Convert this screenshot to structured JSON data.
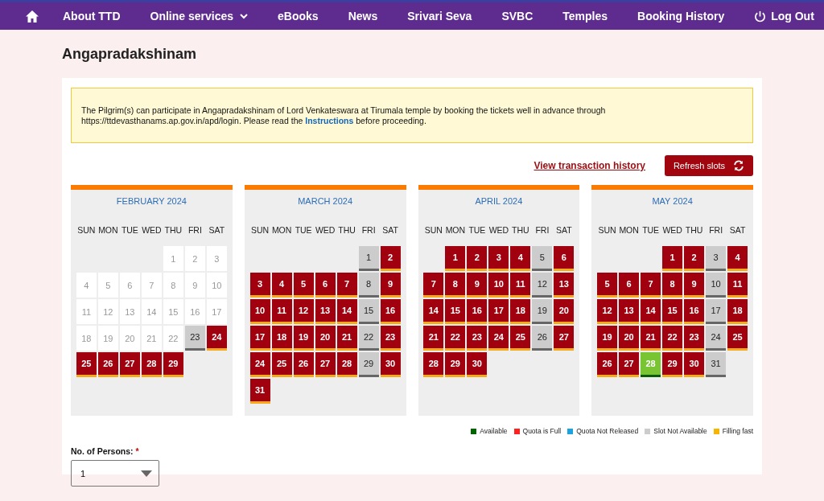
{
  "nav": {
    "items": [
      {
        "label": "About TTD",
        "dropdown": false
      },
      {
        "label": "Online services",
        "dropdown": true
      },
      {
        "label": "eBooks",
        "dropdown": false
      },
      {
        "label": "News",
        "dropdown": false
      },
      {
        "label": "Srivari Seva",
        "dropdown": false
      },
      {
        "label": "SVBC",
        "dropdown": false
      },
      {
        "label": "Temples",
        "dropdown": false
      },
      {
        "label": "Booking History",
        "dropdown": false
      }
    ],
    "logout": "Log Out"
  },
  "page_title": "Angapradakshinam",
  "notice": {
    "before": "The Pilgrim(s) can participate in Angapradakshinam of Lord Venkateswara at Tirumala temple by booking the tickets well in advance through https://ttdevasthanams.ap.gov.in/apd/login. Please read the",
    "link": "Instructions",
    "after": "before proceeding."
  },
  "history_link": "View transaction history",
  "refresh_button": "Refresh slots",
  "months": [
    {
      "title": "FEBRUARY 2024",
      "weekdays": [
        "SUN",
        "MON",
        "TUE",
        "WED",
        "THU",
        "FRI",
        "SAT"
      ],
      "weeks": [
        [
          {
            "kind": "empty"
          },
          {
            "kind": "empty"
          },
          {
            "kind": "empty"
          },
          {
            "kind": "empty"
          },
          {
            "day": "1",
            "kind": "past"
          },
          {
            "day": "2",
            "kind": "past"
          },
          {
            "day": "3",
            "kind": "past"
          }
        ],
        [
          {
            "day": "4",
            "kind": "past"
          },
          {
            "day": "5",
            "kind": "past"
          },
          {
            "day": "6",
            "kind": "past"
          },
          {
            "day": "7",
            "kind": "past"
          },
          {
            "day": "8",
            "kind": "past"
          },
          {
            "day": "9",
            "kind": "past"
          },
          {
            "day": "10",
            "kind": "past"
          }
        ],
        [
          {
            "day": "11",
            "kind": "past"
          },
          {
            "day": "12",
            "kind": "past"
          },
          {
            "day": "13",
            "kind": "past"
          },
          {
            "day": "14",
            "kind": "past"
          },
          {
            "day": "15",
            "kind": "past"
          },
          {
            "day": "16",
            "kind": "past"
          },
          {
            "day": "17",
            "kind": "past"
          }
        ],
        [
          {
            "day": "18",
            "kind": "past"
          },
          {
            "day": "19",
            "kind": "past"
          },
          {
            "day": "20",
            "kind": "past"
          },
          {
            "day": "21",
            "kind": "past"
          },
          {
            "day": "22",
            "kind": "past"
          },
          {
            "day": "23",
            "kind": "not_available"
          },
          {
            "day": "24",
            "kind": "filling_fast"
          }
        ],
        [
          {
            "day": "25",
            "kind": "filling_fast"
          },
          {
            "day": "26",
            "kind": "filling_fast"
          },
          {
            "day": "27",
            "kind": "filling_fast"
          },
          {
            "day": "28",
            "kind": "filling_fast"
          },
          {
            "day": "29",
            "kind": "filling_fast"
          }
        ]
      ]
    },
    {
      "title": "MARCH 2024",
      "weekdays": [
        "SUN",
        "MON",
        "TUE",
        "WED",
        "THU",
        "FRI",
        "SAT"
      ],
      "weeks": [
        [
          {
            "kind": "empty"
          },
          {
            "kind": "empty"
          },
          {
            "kind": "empty"
          },
          {
            "kind": "empty"
          },
          {
            "kind": "empty"
          },
          {
            "day": "1",
            "kind": "not_available"
          },
          {
            "day": "2",
            "kind": "filling_fast"
          }
        ],
        [
          {
            "day": "3",
            "kind": "filling_fast"
          },
          {
            "day": "4",
            "kind": "filling_fast"
          },
          {
            "day": "5",
            "kind": "filling_fast"
          },
          {
            "day": "6",
            "kind": "filling_fast"
          },
          {
            "day": "7",
            "kind": "filling_fast"
          },
          {
            "day": "8",
            "kind": "not_available"
          },
          {
            "day": "9",
            "kind": "filling_fast"
          }
        ],
        [
          {
            "day": "10",
            "kind": "filling_fast"
          },
          {
            "day": "11",
            "kind": "filling_fast"
          },
          {
            "day": "12",
            "kind": "filling_fast"
          },
          {
            "day": "13",
            "kind": "filling_fast"
          },
          {
            "day": "14",
            "kind": "filling_fast"
          },
          {
            "day": "15",
            "kind": "not_available"
          },
          {
            "day": "16",
            "kind": "filling_fast"
          }
        ],
        [
          {
            "day": "17",
            "kind": "filling_fast"
          },
          {
            "day": "18",
            "kind": "filling_fast"
          },
          {
            "day": "19",
            "kind": "filling_fast"
          },
          {
            "day": "20",
            "kind": "filling_fast"
          },
          {
            "day": "21",
            "kind": "filling_fast"
          },
          {
            "day": "22",
            "kind": "not_available"
          },
          {
            "day": "23",
            "kind": "filling_fast"
          }
        ],
        [
          {
            "day": "24",
            "kind": "filling_fast"
          },
          {
            "day": "25",
            "kind": "filling_fast"
          },
          {
            "day": "26",
            "kind": "filling_fast"
          },
          {
            "day": "27",
            "kind": "filling_fast"
          },
          {
            "day": "28",
            "kind": "filling_fast"
          },
          {
            "day": "29",
            "kind": "not_available"
          },
          {
            "day": "30",
            "kind": "filling_fast"
          }
        ],
        [
          {
            "day": "31",
            "kind": "filling_fast"
          }
        ]
      ]
    },
    {
      "title": "APRIL 2024",
      "weekdays": [
        "SUN",
        "MON",
        "TUE",
        "WED",
        "THU",
        "FRI",
        "SAT"
      ],
      "weeks": [
        [
          {
            "kind": "empty"
          },
          {
            "day": "1",
            "kind": "filling_fast"
          },
          {
            "day": "2",
            "kind": "filling_fast"
          },
          {
            "day": "3",
            "kind": "filling_fast"
          },
          {
            "day": "4",
            "kind": "filling_fast"
          },
          {
            "day": "5",
            "kind": "not_available"
          },
          {
            "day": "6",
            "kind": "filling_fast"
          }
        ],
        [
          {
            "day": "7",
            "kind": "filling_fast"
          },
          {
            "day": "8",
            "kind": "filling_fast"
          },
          {
            "day": "9",
            "kind": "filling_fast"
          },
          {
            "day": "10",
            "kind": "filling_fast"
          },
          {
            "day": "11",
            "kind": "filling_fast"
          },
          {
            "day": "12",
            "kind": "not_available"
          },
          {
            "day": "13",
            "kind": "filling_fast"
          }
        ],
        [
          {
            "day": "14",
            "kind": "filling_fast"
          },
          {
            "day": "15",
            "kind": "filling_fast"
          },
          {
            "day": "16",
            "kind": "filling_fast"
          },
          {
            "day": "17",
            "kind": "filling_fast"
          },
          {
            "day": "18",
            "kind": "filling_fast"
          },
          {
            "day": "19",
            "kind": "not_available"
          },
          {
            "day": "20",
            "kind": "filling_fast"
          }
        ],
        [
          {
            "day": "21",
            "kind": "filling_fast"
          },
          {
            "day": "22",
            "kind": "filling_fast"
          },
          {
            "day": "23",
            "kind": "filling_fast"
          },
          {
            "day": "24",
            "kind": "filling_fast"
          },
          {
            "day": "25",
            "kind": "filling_fast"
          },
          {
            "day": "26",
            "kind": "not_available"
          },
          {
            "day": "27",
            "kind": "filling_fast"
          }
        ],
        [
          {
            "day": "28",
            "kind": "filling_fast"
          },
          {
            "day": "29",
            "kind": "filling_fast"
          },
          {
            "day": "30",
            "kind": "filling_fast"
          }
        ]
      ]
    },
    {
      "title": "MAY 2024",
      "weekdays": [
        "SUN",
        "MON",
        "TUE",
        "WED",
        "THU",
        "FRI",
        "SAT"
      ],
      "weeks": [
        [
          {
            "kind": "empty"
          },
          {
            "kind": "empty"
          },
          {
            "kind": "empty"
          },
          {
            "day": "1",
            "kind": "filling_fast"
          },
          {
            "day": "2",
            "kind": "filling_fast"
          },
          {
            "day": "3",
            "kind": "not_available"
          },
          {
            "day": "4",
            "kind": "filling_fast"
          }
        ],
        [
          {
            "day": "5",
            "kind": "filling_fast"
          },
          {
            "day": "6",
            "kind": "filling_fast"
          },
          {
            "day": "7",
            "kind": "filling_fast"
          },
          {
            "day": "8",
            "kind": "filling_fast"
          },
          {
            "day": "9",
            "kind": "filling_fast"
          },
          {
            "day": "10",
            "kind": "not_available"
          },
          {
            "day": "11",
            "kind": "filling_fast"
          }
        ],
        [
          {
            "day": "12",
            "kind": "filling_fast"
          },
          {
            "day": "13",
            "kind": "filling_fast"
          },
          {
            "day": "14",
            "kind": "filling_fast"
          },
          {
            "day": "15",
            "kind": "filling_fast"
          },
          {
            "day": "16",
            "kind": "filling_fast"
          },
          {
            "day": "17",
            "kind": "not_available"
          },
          {
            "day": "18",
            "kind": "filling_fast"
          }
        ],
        [
          {
            "day": "19",
            "kind": "filling_fast"
          },
          {
            "day": "20",
            "kind": "filling_fast"
          },
          {
            "day": "21",
            "kind": "filling_fast"
          },
          {
            "day": "22",
            "kind": "filling_fast"
          },
          {
            "day": "23",
            "kind": "filling_fast"
          },
          {
            "day": "24",
            "kind": "not_available"
          },
          {
            "day": "25",
            "kind": "filling_fast"
          }
        ],
        [
          {
            "day": "26",
            "kind": "filling_fast"
          },
          {
            "day": "27",
            "kind": "filling_fast"
          },
          {
            "day": "28",
            "kind": "available"
          },
          {
            "day": "29",
            "kind": "filling_fast"
          },
          {
            "day": "30",
            "kind": "filling_fast"
          },
          {
            "day": "31",
            "kind": "not_available"
          }
        ]
      ]
    }
  ],
  "legend": [
    {
      "label": "Available",
      "color": "#006400"
    },
    {
      "label": "Quota is Full",
      "color": "#ff2020"
    },
    {
      "label": "Quota Not Released",
      "color": "#1aa3e0"
    },
    {
      "label": "Slot Not Available",
      "color": "#cccccc"
    },
    {
      "label": "Filling fast",
      "color": "#f7b500"
    }
  ],
  "persons": {
    "label": "No. of Persons:",
    "required_mark": "*",
    "value": "1"
  }
}
